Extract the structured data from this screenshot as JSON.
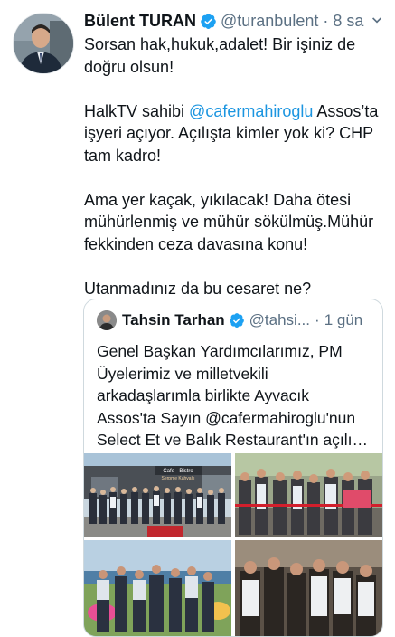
{
  "tweet": {
    "name": "Bülent TURAN",
    "handle": "@turanbulent",
    "separator": "·",
    "time": "8 sa",
    "paragraph1": "Sorsan hak,hukuk,adalet! Bir işiniz de doğru olsun!",
    "p2_before": "HalkTV sahibi ",
    "p2_mention": "@cafermahiroglu",
    "p2_after": " Assos’ta işyeri açıyor. Açılışta kimler yok ki? CHP tam kadro!",
    "paragraph3": "Ama yer kaçak, yıkılacak! Daha ötesi mühürlenmiş ve mühür sökülmüş.Mühür fekkinden ceza davasına konu!",
    "paragraph4": "Utanmadınız da bu cesaret ne?"
  },
  "quoted": {
    "name": "Tahsin Tarhan",
    "handle": "@tahsi...",
    "separator": "·",
    "time": "1 gün",
    "lines": [
      "Genel Başkan Yardımcılarımız, PM",
      "Üyelerimiz ve milletvekili",
      "arkadaşlarımla birlikte Ayvacık",
      "Assos'ta Sayın @cafermahiroglu'nun",
      "Select Et ve Balık Restaurant'ın açılı…"
    ],
    "photo1_sign": "Cafe · Bistro",
    "photo1_sign2": "Serpme Kahvaltı"
  },
  "colors": {
    "link": "#1b95e0",
    "verified": "#1da1f2",
    "secondary_text": "#5b7083",
    "border": "#cfd9de"
  },
  "icons": {
    "verified": "verified-badge-icon",
    "more": "more-options-icon"
  }
}
